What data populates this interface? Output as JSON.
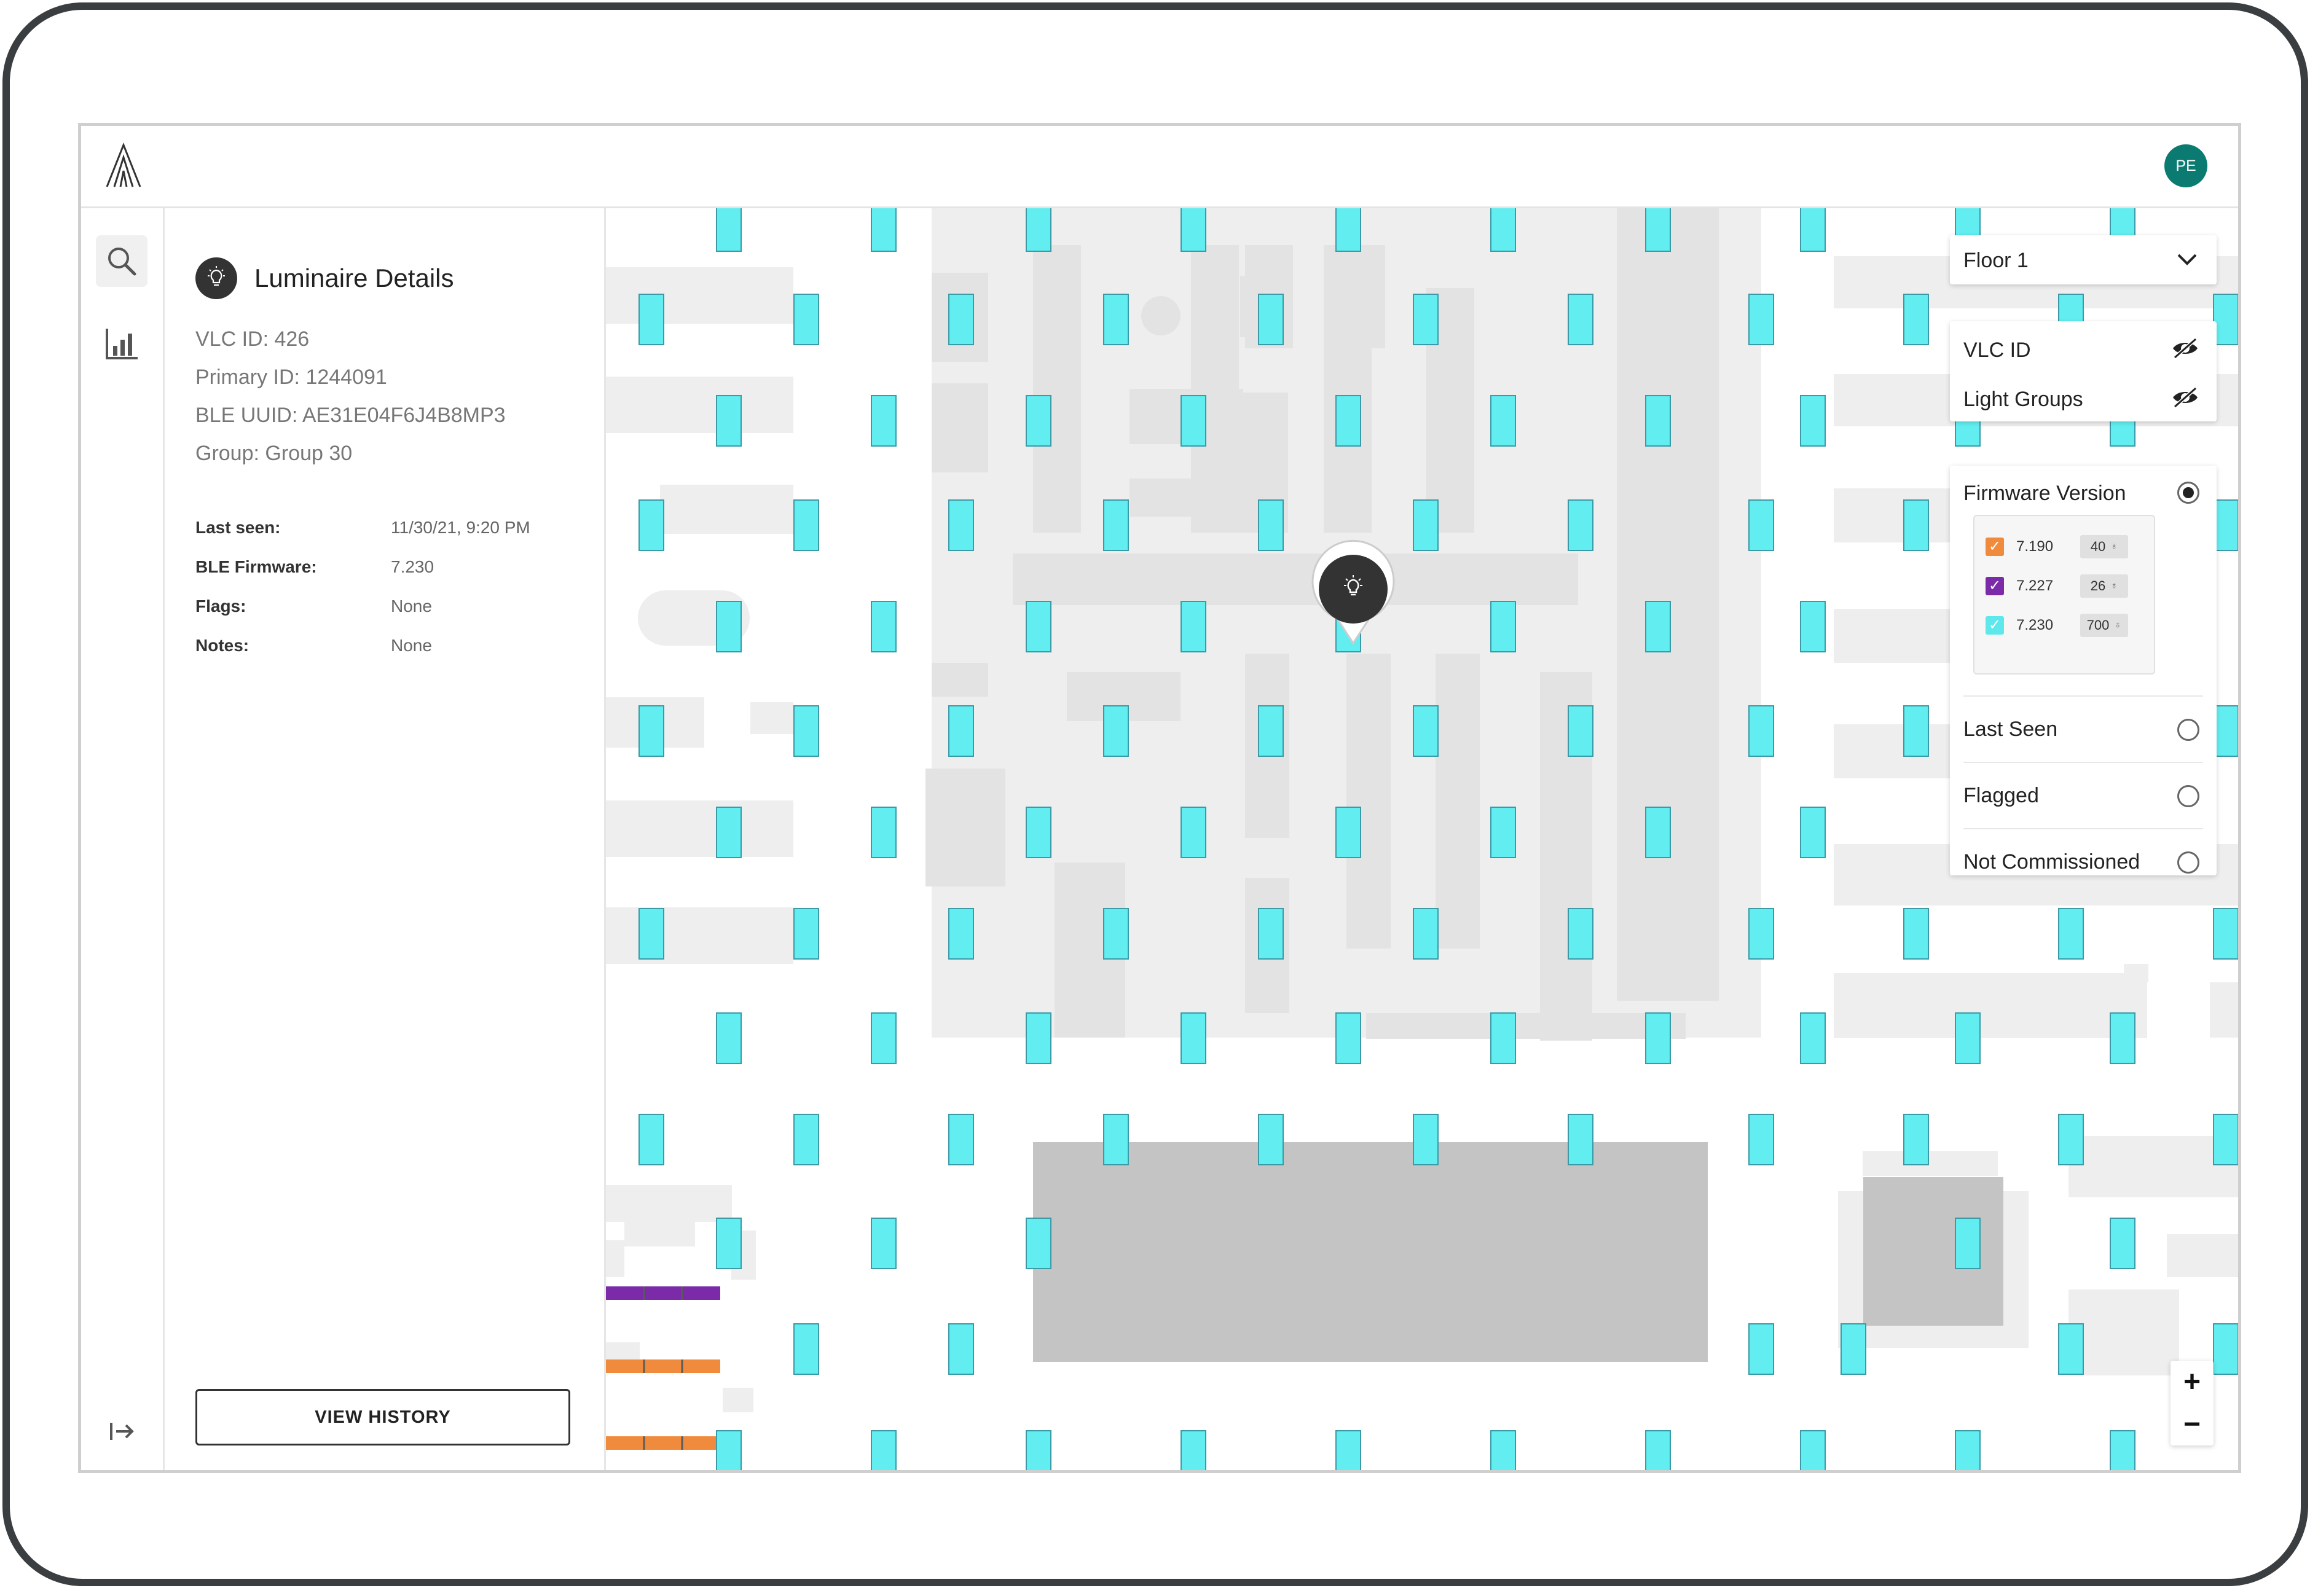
{
  "user": {
    "initials": "PE"
  },
  "panel": {
    "title": "Luminaire Details",
    "vlc_id": "VLC ID: 426",
    "primary_id": "Primary ID: 1244091",
    "ble_uuid": "BLE UUID: AE31E04F6J4B8MP3",
    "group": "Group: Group 30",
    "properties": [
      {
        "key": "Last seen:",
        "value": "11/30/21, 9:20 PM"
      },
      {
        "key": "BLE Firmware:",
        "value": "7.230"
      },
      {
        "key": "Flags:",
        "value": "None"
      },
      {
        "key": "Notes:",
        "value": "None"
      }
    ],
    "history_button": "VIEW HISTORY"
  },
  "map_controls": {
    "floor": "Floor 1",
    "layers": [
      {
        "label": "VLC ID",
        "icon": "eye-off-icon"
      },
      {
        "label": "Light Groups",
        "icon": "eye-off-icon"
      }
    ],
    "modes": [
      {
        "label": "Firmware Version",
        "selected": true
      },
      {
        "label": "Last Seen",
        "selected": false
      },
      {
        "label": "Flagged",
        "selected": false
      },
      {
        "label": "Not Commissioned",
        "selected": false
      }
    ],
    "firmware_legend": [
      {
        "version": "7.190",
        "count": "40",
        "color": "#f08a3c"
      },
      {
        "version": "7.227",
        "count": "26",
        "color": "#7b2aa8"
      },
      {
        "version": "7.230",
        "count": "700",
        "color": "#5ee8ec"
      }
    ]
  },
  "colors": {
    "fixture_fill": "#62eef0",
    "fixture_stroke": "#3a9aa6",
    "avatar": "#0b7b72",
    "fw_7190": "#f08a3c",
    "fw_7227": "#7b2aa8"
  }
}
